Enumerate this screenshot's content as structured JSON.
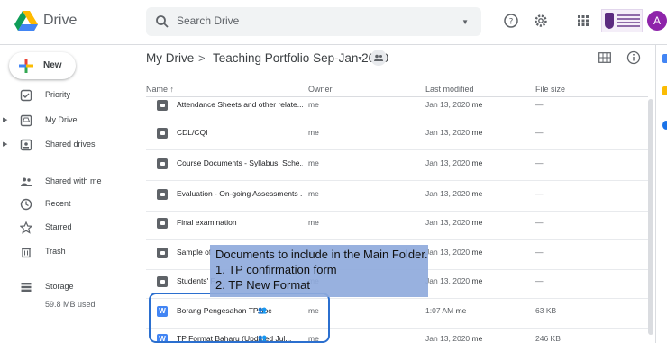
{
  "app": {
    "title": "Drive",
    "avatar_letter": "A"
  },
  "search": {
    "placeholder": "Search Drive"
  },
  "header_icons": [
    "help-icon",
    "settings-icon",
    "apps-icon"
  ],
  "sidebar": {
    "new_label": "New",
    "items": [
      {
        "label": "Priority",
        "icon": "priority-icon",
        "expandable": false
      },
      {
        "label": "My Drive",
        "icon": "my-drive-icon",
        "expandable": true
      },
      {
        "label": "Shared drives",
        "icon": "shared-drives-icon",
        "expandable": true
      },
      {
        "label": "Shared with me",
        "icon": "shared-with-me-icon",
        "expandable": false
      },
      {
        "label": "Recent",
        "icon": "recent-icon",
        "expandable": false
      },
      {
        "label": "Starred",
        "icon": "starred-icon",
        "expandable": false
      },
      {
        "label": "Trash",
        "icon": "trash-icon",
        "expandable": false
      },
      {
        "label": "Storage",
        "icon": "storage-icon",
        "expandable": false
      }
    ],
    "storage_used": "59.8 MB used"
  },
  "breadcrumb": {
    "root": "My Drive",
    "separator": ">",
    "current": "Teaching Portfolio Sep-Jan 2020"
  },
  "columns": {
    "name": "Name",
    "sort_arrow": "↑",
    "owner": "Owner",
    "modified": "Last modified",
    "size": "File size"
  },
  "files": [
    {
      "name": "Attendance Sheets and other relate...",
      "type": "folder",
      "shared": "",
      "owner": "me",
      "modified": "Jan 13, 2020",
      "modified_by": "me",
      "size": "—"
    },
    {
      "name": "CDL/CQI",
      "type": "folder",
      "shared": "",
      "owner": "me",
      "modified": "Jan 13, 2020",
      "modified_by": "me",
      "size": "—"
    },
    {
      "name": "Course Documents - Syllabus, Sche...",
      "type": "folder",
      "shared": "",
      "owner": "me",
      "modified": "Jan 13, 2020",
      "modified_by": "me",
      "size": "—"
    },
    {
      "name": "Evaluation - On-going Assessments ...",
      "type": "folder",
      "shared": "",
      "owner": "me",
      "modified": "Jan 13, 2020",
      "modified_by": "me",
      "size": "—"
    },
    {
      "name": "Final examination",
      "type": "folder",
      "shared": "",
      "owner": "me",
      "modified": "Jan 13, 2020",
      "modified_by": "me",
      "size": "—"
    },
    {
      "name": "Sample of",
      "type": "folder",
      "shared": "",
      "owner": "me",
      "modified": "Jan 13, 2020",
      "modified_by": "me",
      "size": "—"
    },
    {
      "name": "Students' F",
      "type": "folder",
      "shared": "",
      "owner": "me",
      "modified": "Jan 13, 2020",
      "modified_by": "me",
      "size": "—"
    },
    {
      "name": "Borang Pengesahan TP.doc",
      "type": "doc",
      "shared": "👥",
      "owner": "me",
      "modified": "1:07 AM",
      "modified_by": "me",
      "size": "63 KB"
    },
    {
      "name": "TP Format Baharu (Updated Jul...",
      "type": "doc",
      "shared": "👥",
      "owner": "me",
      "modified": "Jan 13, 2020",
      "modified_by": "me",
      "size": "246 KB"
    }
  ],
  "callout": {
    "title": "Documents to include in the Main Folder.",
    "lines": [
      "1.   TP confirmation form",
      "2.   TP New Format"
    ]
  },
  "colors": {
    "accent": "#1a73e8",
    "callout_bg": "#8faadc",
    "highlight_border": "#2b6fcf"
  }
}
